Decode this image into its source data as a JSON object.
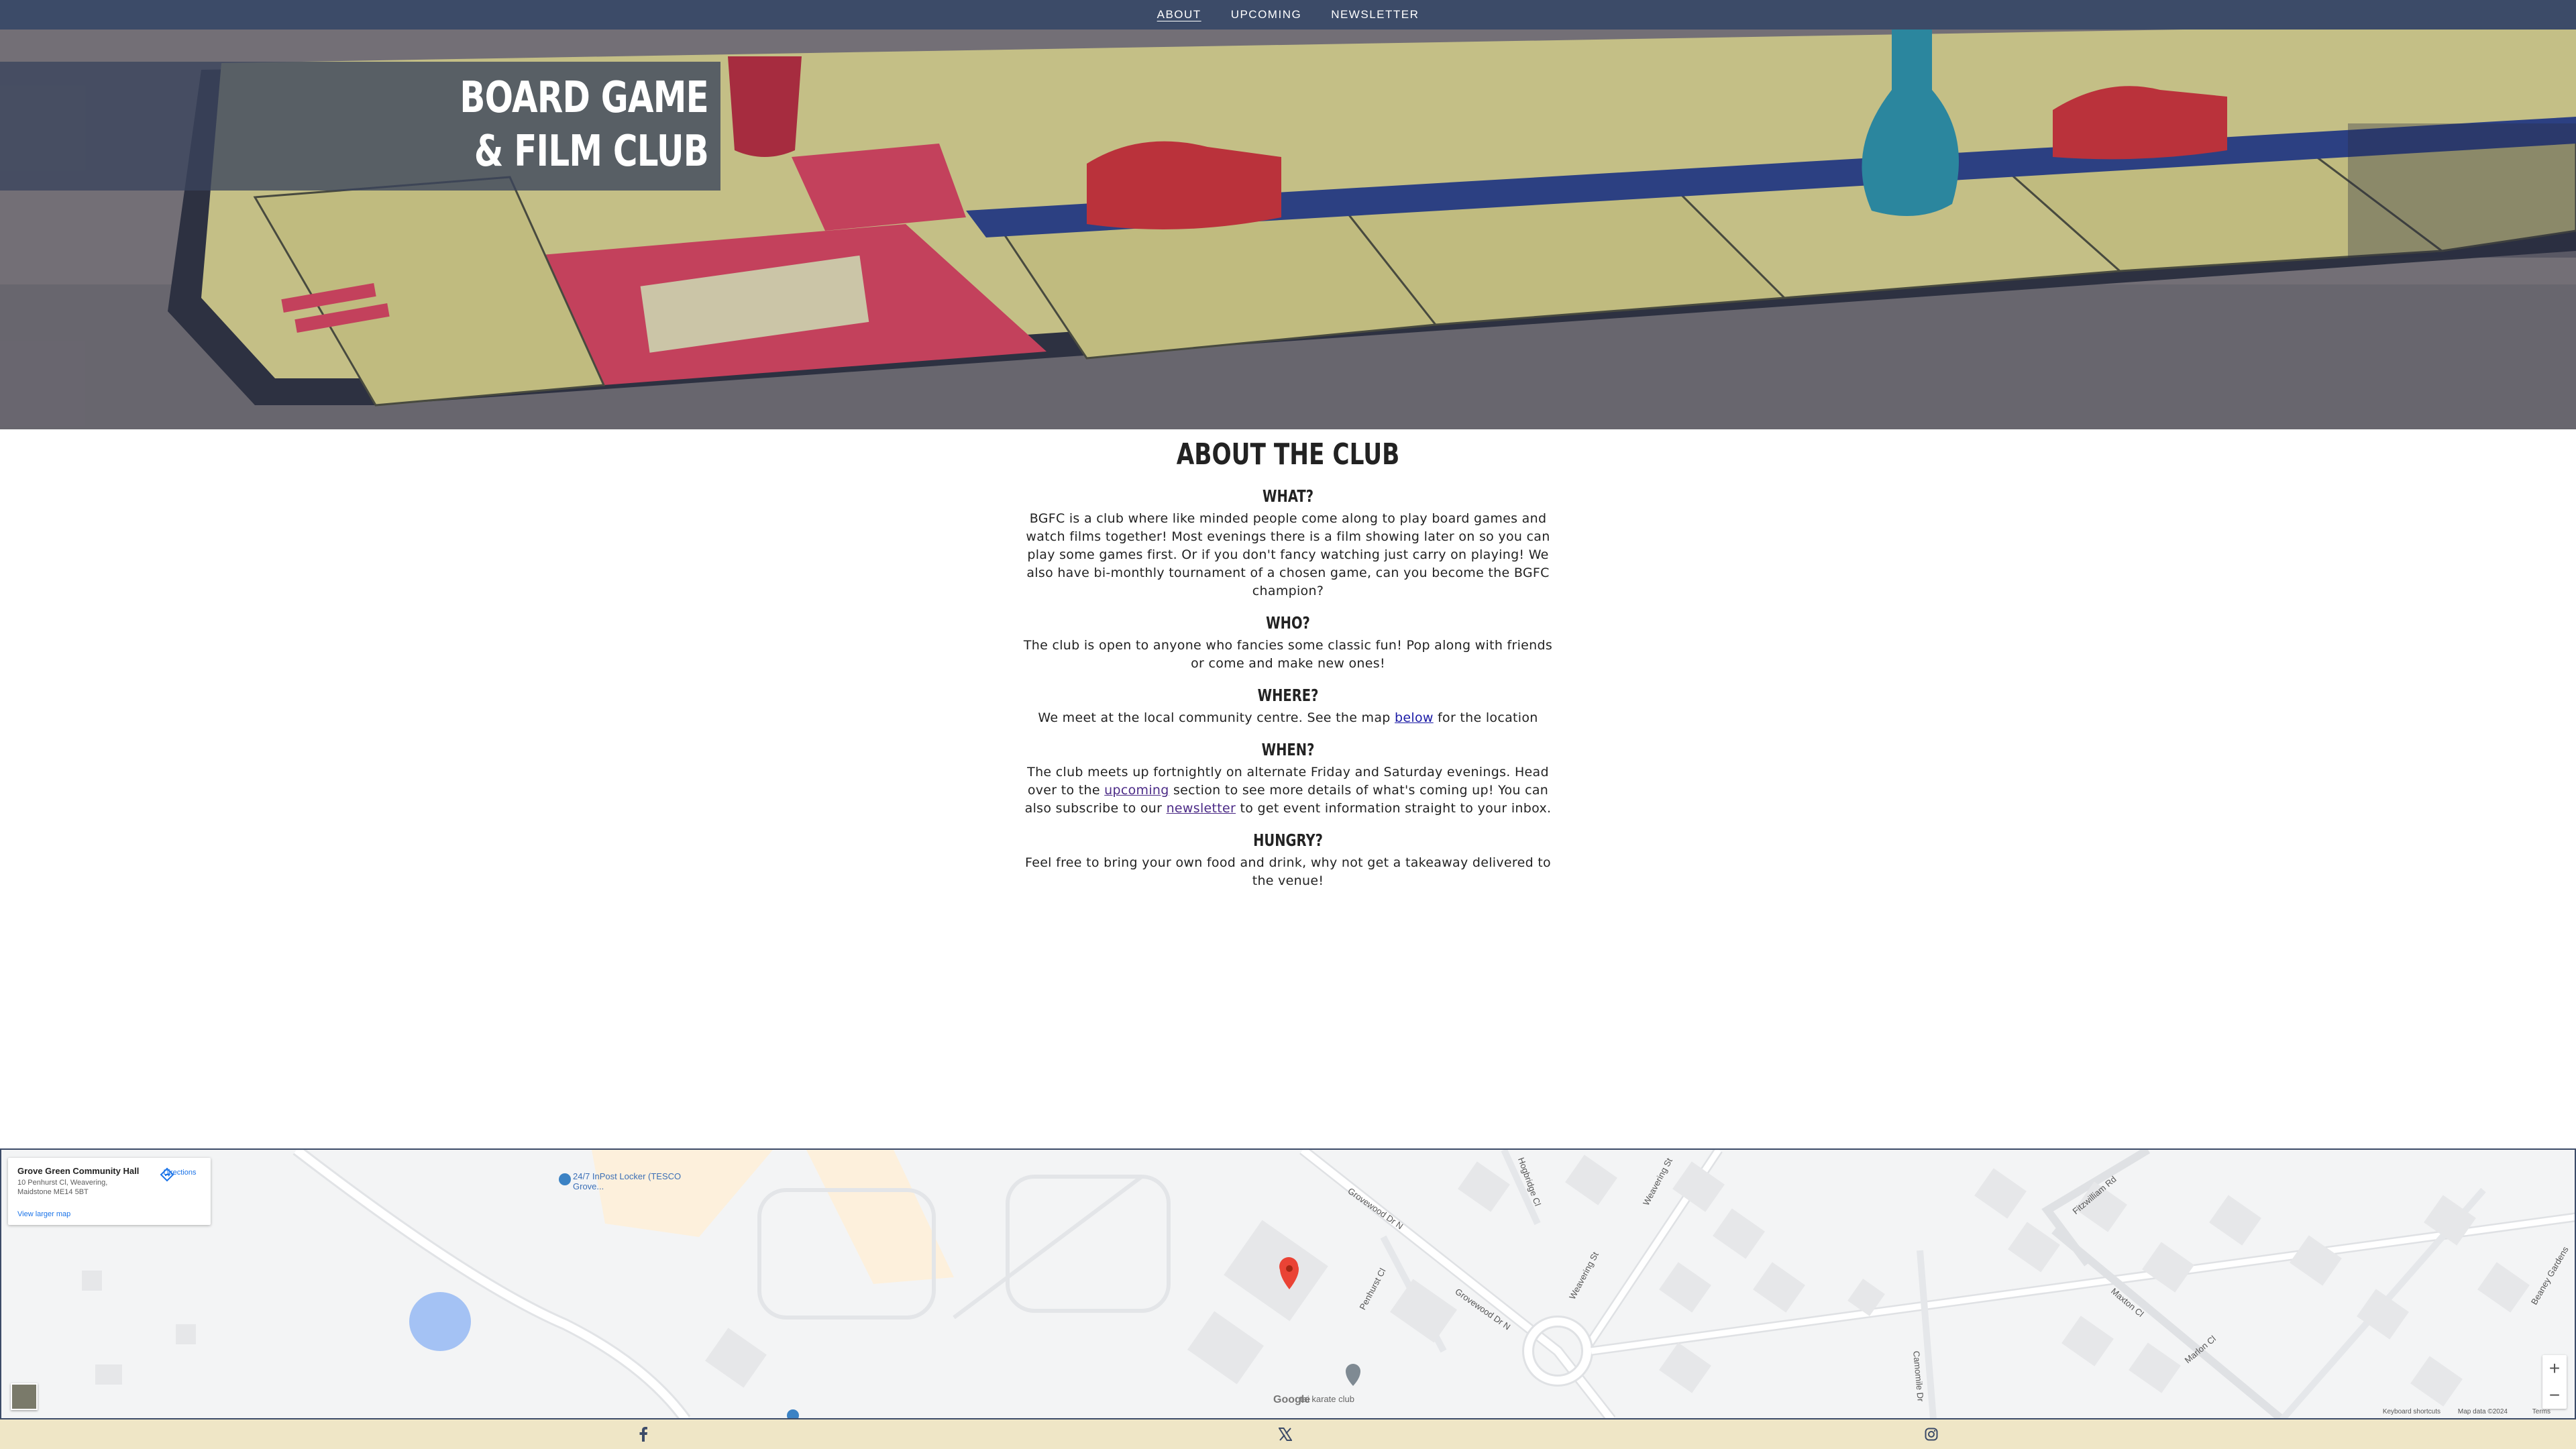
{
  "nav": {
    "items": [
      {
        "label": "ABOUT",
        "active": true
      },
      {
        "label": "UPCOMING",
        "active": false
      },
      {
        "label": "NEWSLETTER",
        "active": false
      }
    ]
  },
  "hero": {
    "title_line1": "BOARD GAME",
    "title_line2": "& FILM CLUB"
  },
  "about": {
    "heading": "ABOUT THE CLUB",
    "what_heading": "WHAT?",
    "what_text": "BGFC is a club where like minded people come along to play board games and watch films together! Most evenings there is a film showing later on so you can play some games first. Or if you don't fancy watching just carry on playing! We also have bi-monthly tournament of a chosen game, can you become the BGFC champion?",
    "who_heading": "WHO?",
    "who_text": "The club is open to anyone who fancies some classic fun! Pop along with friends or come and make new ones!",
    "where_heading": "WHERE?",
    "where_text_before": "We meet at the local community centre. See the map ",
    "where_link": "below",
    "where_text_after": " for the location",
    "when_heading": "WHEN?",
    "when_text_1": "The club meets up fortnightly on alternate Friday and Saturday evenings. Head over to the ",
    "when_link_upcoming": "upcoming",
    "when_text_2": " section to see more details of what's coming up! You can also subscribe to our ",
    "when_link_newsletter": "newsletter",
    "when_text_3": " to get event information straight to your inbox.",
    "hungry_heading": "HUNGRY?",
    "hungry_text": "Feel free to bring your own food and drink, why not get a takeaway delivered to the venue!"
  },
  "map": {
    "place_name": "Grove Green Community Hall",
    "address": "10 Penhurst Cl, Weavering, Maidstone ME14 5BT",
    "directions_label": "Directions",
    "view_larger": "View larger map",
    "poi_1": "24/7 InPost Locker (TESCO Grove...",
    "poi_2": "tai karate club",
    "streets": [
      "Grovewood Dr N",
      "Grovewood Dr N",
      "Penhurst Cl",
      "Weavering St",
      "Weavering St",
      "Hogbridge Cl",
      "Fitzwilliam Rd",
      "Maxton Cl",
      "Marlon Cl",
      "Camomile Dr",
      "Beaney Gardens"
    ],
    "google_label": "Google",
    "footer_shortcuts": "Keyboard shortcuts",
    "footer_data": "Map data ©2024",
    "footer_terms": "Terms",
    "zoom_in": "+",
    "zoom_out": "−"
  },
  "footer": {
    "icons": [
      "facebook-icon",
      "x-icon",
      "instagram-icon"
    ]
  },
  "colors": {
    "nav_bg": "#3c4b68",
    "footer_bg": "#efe6c6",
    "link": "#1a1aa6"
  }
}
